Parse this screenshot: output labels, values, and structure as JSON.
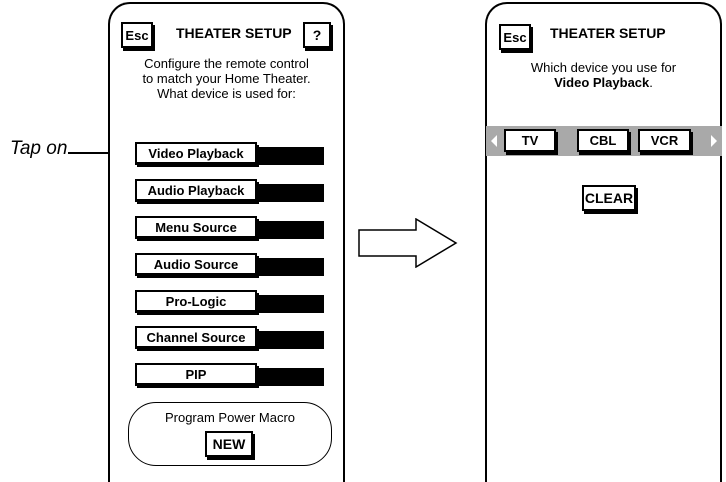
{
  "annotation": {
    "tap_label": "Tap on"
  },
  "left_screen": {
    "esc_label": "Esc",
    "title": "THEATER SETUP",
    "help_label": "?",
    "description": [
      "Configure the remote control",
      "to match your Home Theater.",
      "What device is used for:"
    ],
    "menu_items": [
      {
        "label": "Video Playback"
      },
      {
        "label": "Audio Playback"
      },
      {
        "label": "Menu Source"
      },
      {
        "label": "Audio Source"
      },
      {
        "label": "Pro-Logic"
      },
      {
        "label": "Channel Source"
      },
      {
        "label": "PIP"
      }
    ],
    "power_macro": {
      "label": "Program Power Macro",
      "button_label": "NEW"
    }
  },
  "transition_arrow": {
    "icon": "right-arrow-outline-icon"
  },
  "right_screen": {
    "esc_label": "Esc",
    "title": "THEATER SETUP",
    "description_line1": "Which device you use for",
    "description_bold": "Video Playback",
    "description_suffix": ".",
    "device_bar": {
      "left_icon": "arrow-left-icon",
      "right_icon": "arrow-right-icon",
      "devices": [
        "TV",
        "CBL",
        "VCR"
      ],
      "color": "#a9a9a9"
    },
    "clear_label": "CLEAR"
  }
}
